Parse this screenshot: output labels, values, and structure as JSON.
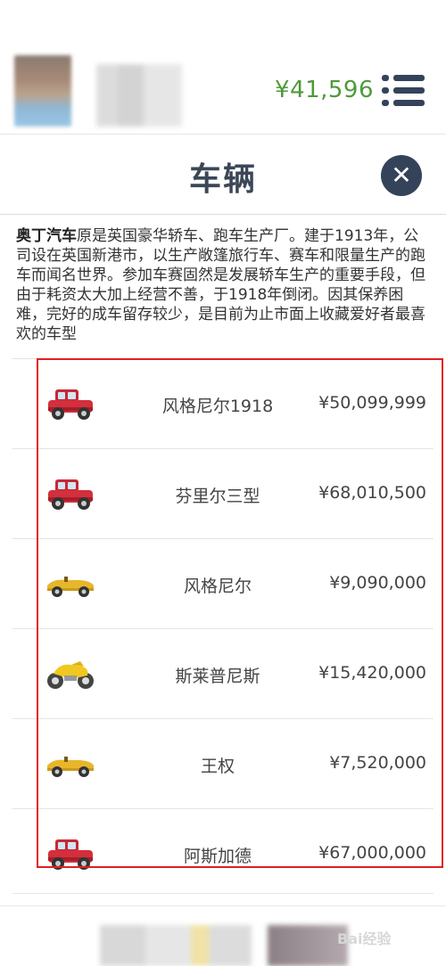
{
  "header": {
    "balance": "¥41,596"
  },
  "dialog": {
    "title": "车辆",
    "description_brand": "奥丁汽车",
    "description_text": "原是英国豪华轿车、跑车生产厂。建于1913年，公司设在英国新港市，以生产敞篷旅行车、赛车和限量生产的跑车而闻名世界。参加车赛固然是发展轿车生产的重要手段，但由于耗资太大加上经营不善，于1918年倒闭。因其保养困难，完好的成车留存较少，是目前为止市面上收藏爱好者最喜欢的车型"
  },
  "vehicles": [
    {
      "name": "风格尼尔1918",
      "price": "¥50,099,999",
      "icon": "red-suv-icon"
    },
    {
      "name": "芬里尔三型",
      "price": "¥68,010,500",
      "icon": "red-suv-icon"
    },
    {
      "name": "风格尼尔",
      "price": "¥9,090,000",
      "icon": "yellow-convertible-icon"
    },
    {
      "name": "斯莱普尼斯",
      "price": "¥15,420,000",
      "icon": "yellow-motorcycle-icon"
    },
    {
      "name": "王权",
      "price": "¥7,520,000",
      "icon": "yellow-convertible-icon"
    },
    {
      "name": "阿斯加德",
      "price": "¥67,000,000",
      "icon": "red-suv-icon"
    }
  ],
  "footer": {
    "watermark": "Bai经验"
  },
  "colors": {
    "balance": "#4e9a3a",
    "accent_dark": "#34435a",
    "highlight": "#e02020"
  }
}
